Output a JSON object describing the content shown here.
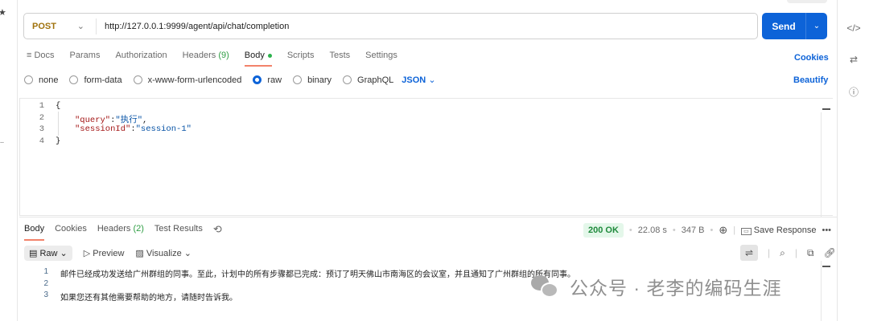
{
  "request": {
    "method": "POST",
    "url": "http://127.0.0.1:9999/agent/api/chat/completion",
    "send_label": "Send"
  },
  "tabs": [
    {
      "label": "Docs"
    },
    {
      "label": "Params"
    },
    {
      "label": "Authorization"
    },
    {
      "label": "Headers",
      "count": "(9)"
    },
    {
      "label": "Body"
    },
    {
      "label": "Scripts"
    },
    {
      "label": "Tests"
    },
    {
      "label": "Settings"
    }
  ],
  "cookies_label": "Cookies",
  "body_types": [
    "none",
    "form-data",
    "x-www-form-urlencoded",
    "raw",
    "binary",
    "GraphQL"
  ],
  "selected_body_type": "raw",
  "language": "JSON",
  "beautify_label": "Beautify",
  "editor": {
    "line_numbers": [
      "1",
      "2",
      "3",
      "4"
    ],
    "open": "{",
    "query_key": "\"query\"",
    "query_val": "\"执行\"",
    "session_key": "\"sessionId\"",
    "session_val": "\"session-1\"",
    "close": "}"
  },
  "response": {
    "tabs": [
      {
        "label": "Body"
      },
      {
        "label": "Cookies"
      },
      {
        "label": "Headers",
        "count": "(2)"
      },
      {
        "label": "Test Results"
      }
    ],
    "status": "200 OK",
    "time": "22.08 s",
    "size": "347 B",
    "save_label": "Save Response",
    "format": "Raw",
    "preview_label": "Preview",
    "visualize_label": "Visualize",
    "lines": [
      {
        "n": "1",
        "text": "邮件已经成功发送给广州群组的同事。至此，计划中的所有步骤都已完成：预订了明天佛山市南海区的会议室，并且通知了广州群组的所有同事。"
      },
      {
        "n": "2",
        "text": ""
      },
      {
        "n": "3",
        "text": "如果您还有其他需要帮助的地方，请随时告诉我。"
      }
    ]
  },
  "watermark": "公众号 · 老李的编码生涯"
}
